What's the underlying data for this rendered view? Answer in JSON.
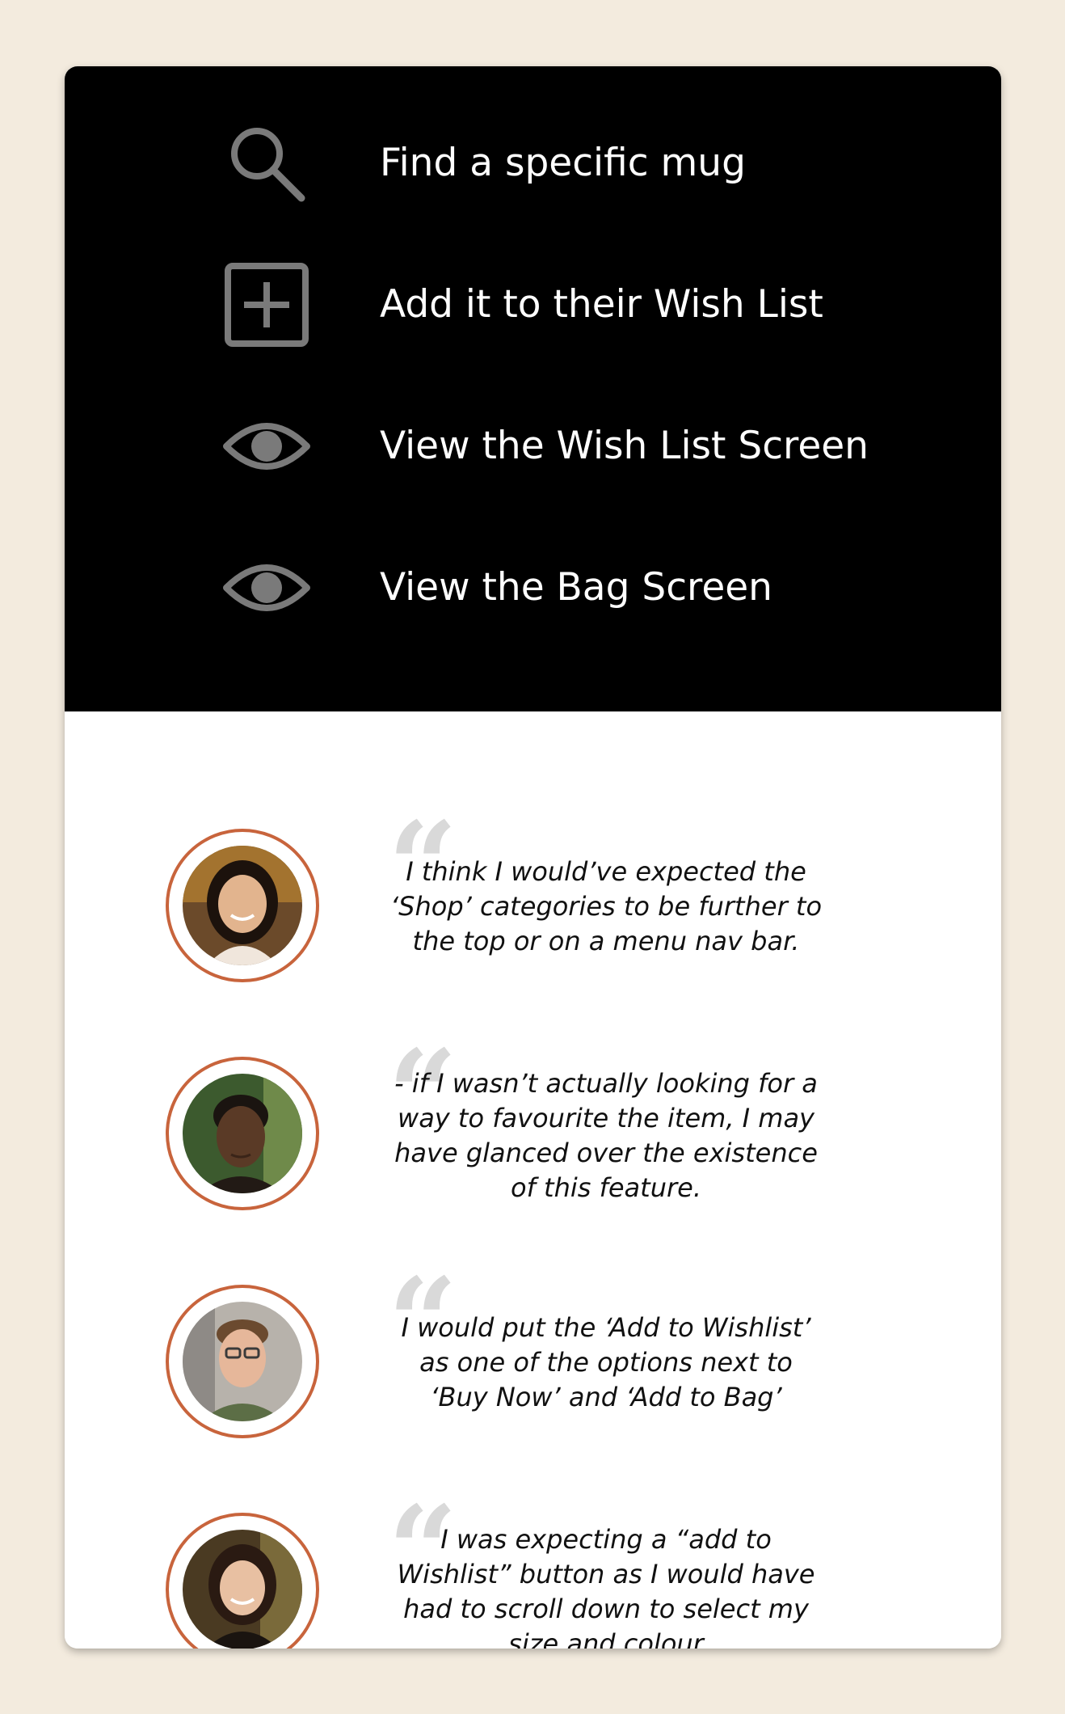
{
  "tasks": [
    {
      "icon": "search-icon",
      "label": "Find a specific mug"
    },
    {
      "icon": "add-box-icon",
      "label": "Add it to their Wish List"
    },
    {
      "icon": "eye-icon",
      "label": "View the Wish List Screen"
    },
    {
      "icon": "eye-icon",
      "label": "View the Bag Screen"
    }
  ],
  "quotes": [
    {
      "avatar": "avatar-woman-1",
      "text": "I think I would’ve expected the ‘Shop’ categories to be further to the top or on a menu nav bar."
    },
    {
      "avatar": "avatar-man-1",
      "text": "- if I wasn’t actually looking for a way to favourite the item, I may have glanced over the existence of this feature."
    },
    {
      "avatar": "avatar-man-2",
      "text": "I would put the ‘Add to Wishlist’ as one of the options next to ‘Buy Now’ and ‘Add to Bag’"
    },
    {
      "avatar": "avatar-woman-2",
      "text": "I was expecting a “add to Wishlist” button as I would have had to scroll down to select my size and colour"
    }
  ],
  "colors": {
    "background": "#f3ebde",
    "accent": "#c8643c",
    "icon_gray": "#7a7a7a"
  }
}
